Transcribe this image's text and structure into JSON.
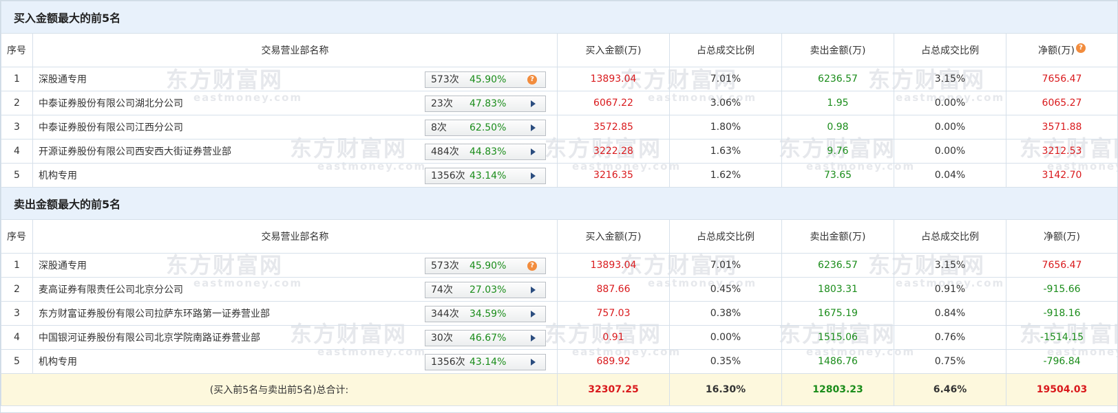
{
  "watermark": {
    "cn": "东方财富网",
    "en": "eastmoney.com"
  },
  "buy_section": {
    "title": "买入金额最大的前5名",
    "headers": [
      "序号",
      "交易营业部名称",
      "买入金额(万)",
      "占总成交比例",
      "卖出金额(万)",
      "占总成交比例",
      "净额(万)"
    ],
    "rows": [
      {
        "idx": "1",
        "name": "深股通专用",
        "count": "573次",
        "pct": "45.90%",
        "icon": "question-icon",
        "buy": "13893.04",
        "buy_ratio": "7.01%",
        "sell": "6236.57",
        "sell_ratio": "3.15%",
        "net": "7656.47"
      },
      {
        "idx": "2",
        "name": "中泰证券股份有限公司湖北分公司",
        "count": "23次",
        "pct": "47.83%",
        "icon": "arrow-right-icon",
        "buy": "6067.22",
        "buy_ratio": "3.06%",
        "sell": "1.95",
        "sell_ratio": "0.00%",
        "net": "6065.27"
      },
      {
        "idx": "3",
        "name": "中泰证券股份有限公司江西分公司",
        "count": "8次",
        "pct": "62.50%",
        "icon": "arrow-right-icon",
        "buy": "3572.85",
        "buy_ratio": "1.80%",
        "sell": "0.98",
        "sell_ratio": "0.00%",
        "net": "3571.88"
      },
      {
        "idx": "4",
        "name": "开源证券股份有限公司西安西大街证券营业部",
        "count": "484次",
        "pct": "44.83%",
        "icon": "arrow-right-icon",
        "buy": "3222.28",
        "buy_ratio": "1.63%",
        "sell": "9.76",
        "sell_ratio": "0.00%",
        "net": "3212.53"
      },
      {
        "idx": "5",
        "name": "机构专用",
        "count": "1356次",
        "pct": "43.14%",
        "icon": "arrow-right-icon",
        "buy": "3216.35",
        "buy_ratio": "1.62%",
        "sell": "73.65",
        "sell_ratio": "0.04%",
        "net": "3142.70"
      }
    ]
  },
  "sell_section": {
    "title": "卖出金额最大的前5名",
    "headers": [
      "序号",
      "交易营业部名称",
      "买入金额(万)",
      "占总成交比例",
      "卖出金额(万)",
      "占总成交比例",
      "净额(万)"
    ],
    "rows": [
      {
        "idx": "1",
        "name": "深股通专用",
        "count": "573次",
        "pct": "45.90%",
        "icon": "question-icon",
        "buy": "13893.04",
        "buy_ratio": "7.01%",
        "sell": "6236.57",
        "sell_ratio": "3.15%",
        "net": "7656.47"
      },
      {
        "idx": "2",
        "name": "麦高证券有限责任公司北京分公司",
        "count": "74次",
        "pct": "27.03%",
        "icon": "arrow-right-icon",
        "buy": "887.66",
        "buy_ratio": "0.45%",
        "sell": "1803.31",
        "sell_ratio": "0.91%",
        "net": "-915.66"
      },
      {
        "idx": "3",
        "name": "东方财富证券股份有限公司拉萨东环路第一证券营业部",
        "count": "344次",
        "pct": "34.59%",
        "icon": "arrow-right-icon",
        "buy": "757.03",
        "buy_ratio": "0.38%",
        "sell": "1675.19",
        "sell_ratio": "0.84%",
        "net": "-918.16"
      },
      {
        "idx": "4",
        "name": "中国银河证券股份有限公司北京学院南路证券营业部",
        "count": "30次",
        "pct": "46.67%",
        "icon": "arrow-right-icon",
        "buy": "0.91",
        "buy_ratio": "0.00%",
        "sell": "1515.06",
        "sell_ratio": "0.76%",
        "net": "-1514.15"
      },
      {
        "idx": "5",
        "name": "机构专用",
        "count": "1356次",
        "pct": "43.14%",
        "icon": "arrow-right-icon",
        "buy": "689.92",
        "buy_ratio": "0.35%",
        "sell": "1486.76",
        "sell_ratio": "0.75%",
        "net": "-796.84"
      }
    ]
  },
  "total": {
    "label": "(买入前5名与卖出前5名)总合计:",
    "buy": "32307.25",
    "buy_ratio": "16.30%",
    "sell": "12803.23",
    "sell_ratio": "6.46%",
    "net": "19504.03"
  },
  "colors": {
    "positive": "#d9191c",
    "sell_value": "#1a8c1a",
    "header_bg": "#e8f1fb",
    "total_bg": "#fdf8dd",
    "help_icon": "#f28c3d"
  },
  "help_glyph": "?"
}
